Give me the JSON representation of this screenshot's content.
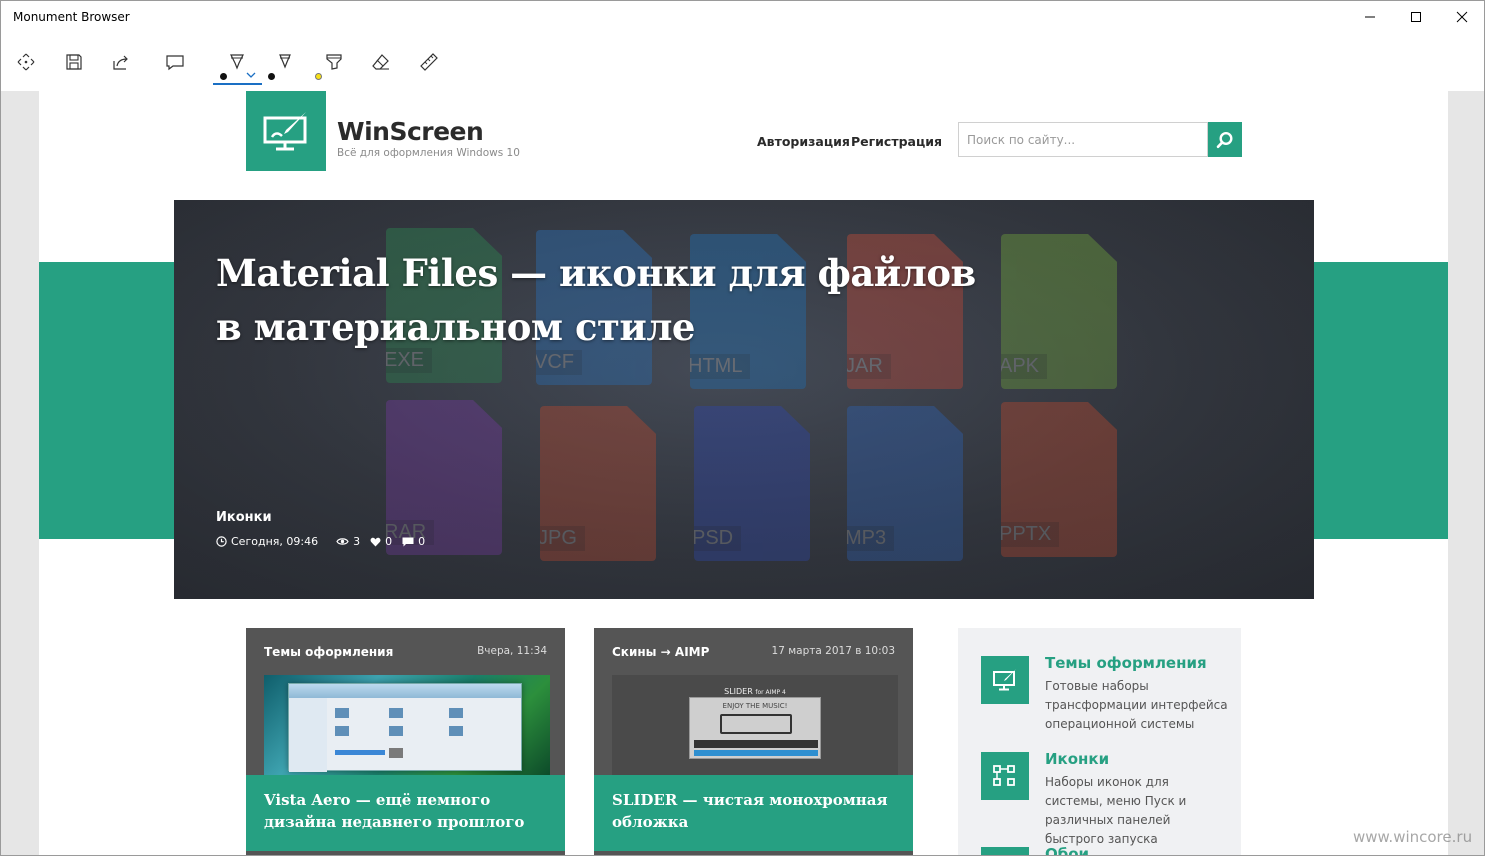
{
  "window": {
    "title": "Monument Browser"
  },
  "site": {
    "brand": "WinScreen",
    "tagline": "Всё для оформления Windows 10",
    "nav": [
      "Авторизация",
      "Регистрация"
    ],
    "search_placeholder": "Поиск по сайту...",
    "accent_color": "#26a082"
  },
  "hero": {
    "title": "Material Files — иконки для файлов в материальном стиле",
    "category": "Иконки",
    "date": "Сегодня, 09:46",
    "views": "3",
    "likes": "0",
    "comments": "0",
    "file_types": [
      "EXE",
      "VCF",
      "HTML",
      "JAR",
      "APK",
      "RAR",
      "JPG",
      "PSD",
      "MP3",
      "PPTX"
    ]
  },
  "cards": [
    {
      "category": "Темы оформления",
      "date": "Вчера, 11:34",
      "title": "Vista Aero — ещё немного дизайна недавнего прошлого"
    },
    {
      "category": "Скины → AIMP",
      "date": "17 марта 2017 в 10:03",
      "title": "SLIDER — чистая монохромная обложка",
      "thumb_caption": "SLIDER",
      "thumb_subcaption": "for AIMP 4",
      "thumb_slogan": "ENJOY THE MUSIC!"
    }
  ],
  "sidebar": [
    {
      "title": "Темы оформления",
      "desc": "Готовые наборы трансформации интерфейса операционной системы"
    },
    {
      "title": "Иконки",
      "desc": "Наборы иконок для системы, меню Пуск и различных панелей быстрого запуска"
    },
    {
      "title": "Обои"
    }
  ],
  "watermark": "www.wincore.ru"
}
